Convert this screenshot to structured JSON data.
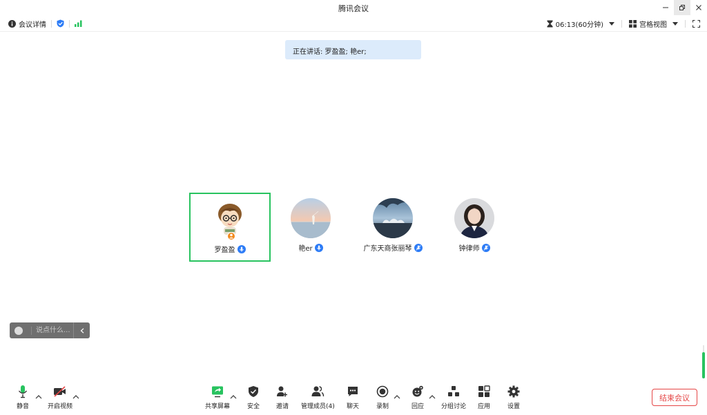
{
  "window": {
    "title": "腾讯会议"
  },
  "infobar": {
    "meeting_details": "会议详情",
    "timer": "06:13(60分钟)",
    "view_mode": "宫格视图"
  },
  "speaking": {
    "text": "正在讲话: 罗盈盈; 艳er;"
  },
  "participants": [
    {
      "name": "罗盈盈",
      "mic": "speaking",
      "host": true
    },
    {
      "name": "艳er",
      "mic": "speaking",
      "host": false
    },
    {
      "name": "广东天商张丽琴",
      "mic": "muted",
      "host": false
    },
    {
      "name": "钟律师",
      "mic": "muted",
      "host": false
    }
  ],
  "chat": {
    "placeholder": "说点什么..."
  },
  "toolbar": {
    "mute": "静音",
    "video": "开启视频",
    "share": "共享屏幕",
    "security": "安全",
    "invite": "邀请",
    "members": "管理成员(4)",
    "chat": "聊天",
    "record": "录制",
    "react": "回应",
    "breakout": "分组讨论",
    "apps": "应用",
    "settings": "设置",
    "end": "结束会议"
  },
  "colors": {
    "accent_green": "#28c35f",
    "accent_blue": "#2d7cf6",
    "end_red": "#e54545",
    "banner_bg": "#dcebfb"
  }
}
